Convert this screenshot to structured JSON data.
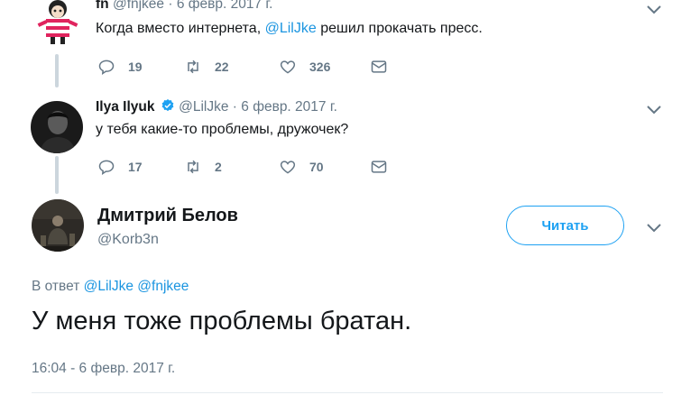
{
  "tweets": [
    {
      "name": "fn",
      "handle": "@fnjkee",
      "separator": "·",
      "date": "6 февр. 2017 г.",
      "text_before": "Когда вместо интернета, ",
      "mention": "@LilJke",
      "text_after": " решил прокачать пресс.",
      "reply_count": "19",
      "retweet_count": "22",
      "like_count": "326"
    },
    {
      "name": "Ilya Ilyuk",
      "handle": "@LilJke",
      "separator": "·",
      "date": "6 февр. 2017 г.",
      "text": "у тебя какие-то проблемы, дружочек?",
      "reply_count": "17",
      "retweet_count": "2",
      "like_count": "70"
    }
  ],
  "main_tweet": {
    "name": "Дмитрий Белов",
    "handle": "@Korb3n",
    "follow_label": "Читать",
    "reply_prefix": "В ответ",
    "reply_mention_1": "@LilJke",
    "reply_mention_2": "@fnjkee",
    "text": "У меня тоже проблемы братан.",
    "timestamp": "16:04 - 6 февр. 2017 г."
  },
  "colors": {
    "accent": "#1da1f2",
    "mention": "#1b95e0",
    "secondary_text": "#657786",
    "thread_line": "#ccd6dd"
  },
  "icons": [
    "reply-icon",
    "retweet-icon",
    "like-icon",
    "direct-message-icon",
    "verified-icon",
    "chevron-down-icon"
  ]
}
